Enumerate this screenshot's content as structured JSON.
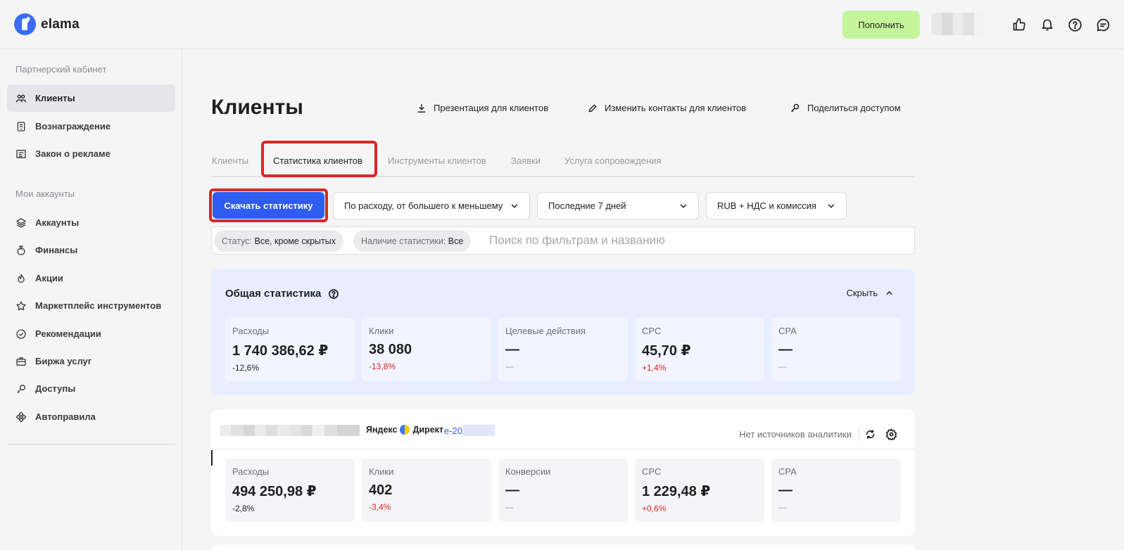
{
  "header": {
    "logo_text": "elama",
    "topup_label": "Пополнить",
    "icons": [
      "thumbs-up-icon",
      "bell-icon",
      "help-icon",
      "chat-icon"
    ]
  },
  "sidebar": {
    "section1": "Партнерский кабинет",
    "items1": [
      {
        "label": "Клиенты",
        "icon": "clients-icon",
        "active": true
      },
      {
        "label": "Вознаграждение",
        "icon": "reward-icon"
      },
      {
        "label": "Закон о рекламе",
        "icon": "law-icon"
      }
    ],
    "section2": "Мои аккаунты",
    "items2": [
      {
        "label": "Аккаунты",
        "icon": "layers-icon"
      },
      {
        "label": "Финансы",
        "icon": "money-bag-icon"
      },
      {
        "label": "Акции",
        "icon": "flame-icon"
      },
      {
        "label": "Маркетплейс инструментов",
        "icon": "star-icon"
      },
      {
        "label": "Рекомендации",
        "icon": "check-circle-icon"
      },
      {
        "label": "Биржа услуг",
        "icon": "briefcase-icon"
      },
      {
        "label": "Доступы",
        "icon": "key-icon"
      },
      {
        "label": "Автоправила",
        "icon": "autorules-icon"
      }
    ]
  },
  "main": {
    "title": "Клиенты",
    "actions": [
      {
        "label": "Презентация для клиентов",
        "icon": "download-icon"
      },
      {
        "label": "Изменить контакты для клиентов",
        "icon": "pencil-icon"
      },
      {
        "label": "Поделиться доступом",
        "icon": "key-icon"
      }
    ],
    "tabs": [
      {
        "label": "Клиенты"
      },
      {
        "label": "Статистика клиентов",
        "active": true
      },
      {
        "label": "Инструменты клиентов"
      },
      {
        "label": "Заявки"
      },
      {
        "label": "Услуга сопровождения"
      }
    ],
    "download_label": "Скачать статистику",
    "selects": [
      {
        "value": "По расходу, от большего к меньшему"
      },
      {
        "value": "Последние 7 дней"
      },
      {
        "value": "RUB + НДС и комиссия"
      }
    ],
    "filters": [
      {
        "key": "Статус:",
        "value": "Все, кроме скрытых"
      },
      {
        "key": "Наличие статистики:",
        "value": "Все"
      }
    ],
    "search_placeholder": "Поиск по фильтрам и названию"
  },
  "general": {
    "title": "Общая статистика",
    "hide_label": "Скрыть",
    "cards": [
      {
        "label": "Расходы",
        "value": "1 740 386,62 ₽",
        "delta": "-12,6%",
        "tone": "dark"
      },
      {
        "label": "Клики",
        "value": "38 080",
        "delta": "-13,8%",
        "tone": "red"
      },
      {
        "label": "Целевые действия",
        "value": "—",
        "delta": "—",
        "tone": "muted"
      },
      {
        "label": "CPC",
        "value": "45,70 ₽",
        "delta": "+1,4%",
        "tone": "red"
      },
      {
        "label": "CPA",
        "value": "—",
        "delta": "—",
        "tone": "muted"
      }
    ]
  },
  "client": {
    "platform_part1": "Яндекс",
    "platform_part2": "Директ",
    "account_prefix": "e-20",
    "no_analytics": "Нет источников аналитики",
    "cards": [
      {
        "label": "Расходы",
        "value": "494 250,98 ₽",
        "delta": "-2,8%",
        "tone": "dark"
      },
      {
        "label": "Клики",
        "value": "402",
        "delta": "-3,4%",
        "tone": "red"
      },
      {
        "label": "Конверсии",
        "value": "—",
        "delta": "—",
        "tone": "muted"
      },
      {
        "label": "CPC",
        "value": "1 229,48 ₽",
        "delta": "+0,6%",
        "tone": "red"
      },
      {
        "label": "CPA",
        "value": "—",
        "delta": "—",
        "tone": "muted"
      }
    ]
  }
}
